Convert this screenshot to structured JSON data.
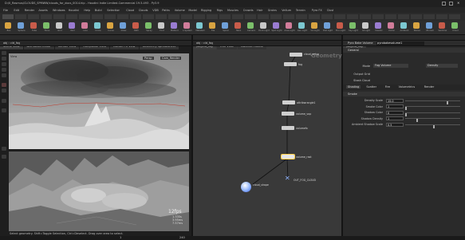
{
  "window": {
    "title": "D:/0_Rasmus/CLOUDS_SPMWW/clouds_for_docs_0014.hip - Houdini Indie Limited-Commercial 19.5.493 - Py3.9"
  },
  "menu": [
    "File",
    "Edit",
    "Render",
    "Assets",
    "Windows",
    "Houdini",
    "Help",
    "Build",
    "Selection",
    "Cloud",
    "Clouds",
    "VDB",
    "Paths",
    "Volume",
    "Model",
    "Rigging",
    "Rigs",
    "Muscles",
    "Crowds",
    "Hair",
    "Grains",
    "Vellum",
    "Terrain",
    "Pyro FX",
    "Dust"
  ],
  "toolbar": {
    "tools": [
      "Box",
      "Sphere",
      "Tube",
      "Torus",
      "Grid",
      "Null",
      "Line",
      "Circle",
      "Curve",
      "Draw",
      "Path",
      "Spray",
      "Font",
      "Platonic",
      "L-System",
      "Metaball",
      "File",
      "Spiral",
      "Helix",
      "Camera",
      "Point Light",
      "Spot Light",
      "Area Light",
      "Geo Light",
      "Vol Light",
      "Dist Light",
      "Env Light",
      "Sky Light",
      "GI Light",
      "Caustic",
      "Portal",
      "Ambient",
      "Stereo",
      "VR Cam",
      "Switcher",
      "Cloud"
    ]
  },
  "left_panel": {
    "tabs": [
      "Scene View",
      "Animation Editor",
      "Render View",
      "Composite View",
      "Motion FX View",
      "Geometry Spreadsheet"
    ],
    "path": "obj › cld_fog",
    "viewport": {
      "view_menu": "View",
      "camera": "Persp",
      "cam_dropdown": "Cam_Render",
      "fps": "12fps",
      "stat_lines": [
        "1.335s",
        "3.95ms",
        "7.57ms"
      ]
    },
    "status": "Select geometry. Shift=Toggle Selection, Ctrl=Deselect. Drag over area to select."
  },
  "network": {
    "tabs": [
      "/obj/cld_fog",
      "Tree View",
      "Material Palette"
    ],
    "path": "obj › cld_fog",
    "context_label": "Geometry",
    "nodes": [
      {
        "label": "cloud_setup"
      },
      {
        "label": "fog"
      },
      {
        "label": "attribwrangle1"
      },
      {
        "label": "volume_vop"
      },
      {
        "label": "volumefx"
      },
      {
        "label": "volume_rast"
      },
      {
        "label": "cloud_shape"
      },
      {
        "label": "OUT_FOG_CLOUD"
      }
    ]
  },
  "params": {
    "tabs": [
      "/obj/cld_fog"
    ],
    "node_type": "Pyro Bake Volume",
    "node_name": "pyrobakevolume1",
    "section": "General",
    "fields": [
      {
        "label": "Mode",
        "value": "Fog Volume"
      },
      {
        "label": "Output Grid",
        "value": "Density"
      },
      {
        "label": "Stash Cloud",
        "value": "Stash Cloud"
      }
    ],
    "subtabs": [
      "Shading",
      "Scatter",
      "Fire",
      "Volumetrics",
      "Render"
    ],
    "smoke_section": "Smoke",
    "rows": [
      {
        "label": "Density Scale",
        "value": "15.0",
        "slider": 0.75
      },
      {
        "label": "Smoke Color",
        "value": "1",
        "slider": 0.0
      },
      {
        "label": "Shadow Color",
        "value": "0",
        "slider": 0.0
      },
      {
        "label": "Shadow Density",
        "value": "1",
        "slider": 0.2
      },
      {
        "label": "Ambient Shadow Scale",
        "value": "0.5",
        "slider": 0.5
      }
    ],
    "bake_label": "Bake"
  },
  "statusbar": {
    "frame": "1",
    "end_frame": "240"
  }
}
